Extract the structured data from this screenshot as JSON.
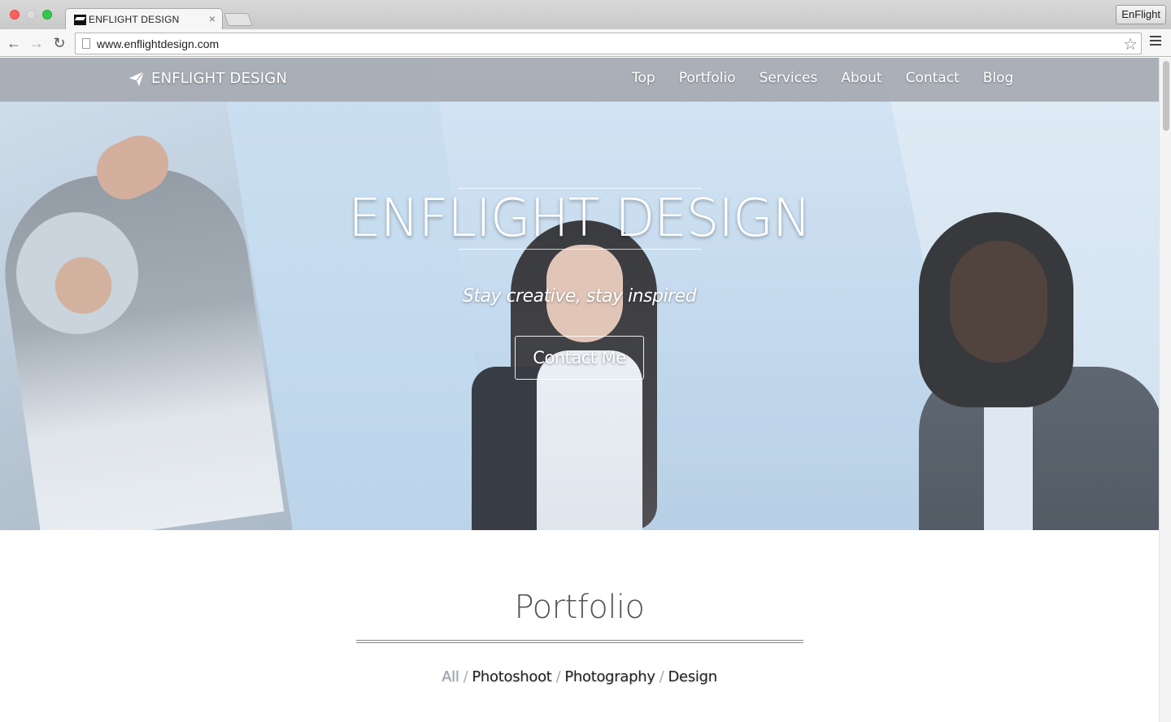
{
  "browser": {
    "tab_title": "ENFLIGHT DESIGN",
    "tab_close": "×",
    "url": "www.enflightdesign.com",
    "profile_label": "EnFlight",
    "icons": {
      "back": "back-arrow-icon",
      "forward": "forward-arrow-icon",
      "reload": "reload-icon",
      "bookmark": "star-icon",
      "menu": "hamburger-menu-icon"
    }
  },
  "site": {
    "brand": "ENFLIGHT DESIGN",
    "brand_icon": "paper-plane-icon",
    "nav": [
      "Top",
      "Portfolio",
      "Services",
      "About",
      "Contact",
      "Blog"
    ]
  },
  "hero": {
    "title": "ENFLIGHT DESIGN",
    "tagline": "Stay creative, stay inspired",
    "cta": "Contact Me"
  },
  "portfolio": {
    "title": "Portfolio",
    "filters": [
      "All",
      "Photoshoot",
      "Photography",
      "Design"
    ],
    "active_filter": "All",
    "separator": "/"
  },
  "colors": {
    "navbar": "#a6aab2",
    "hero_tint": "#c7dcef",
    "active_filter": "#9aa0ab",
    "text_dark": "#222222"
  }
}
